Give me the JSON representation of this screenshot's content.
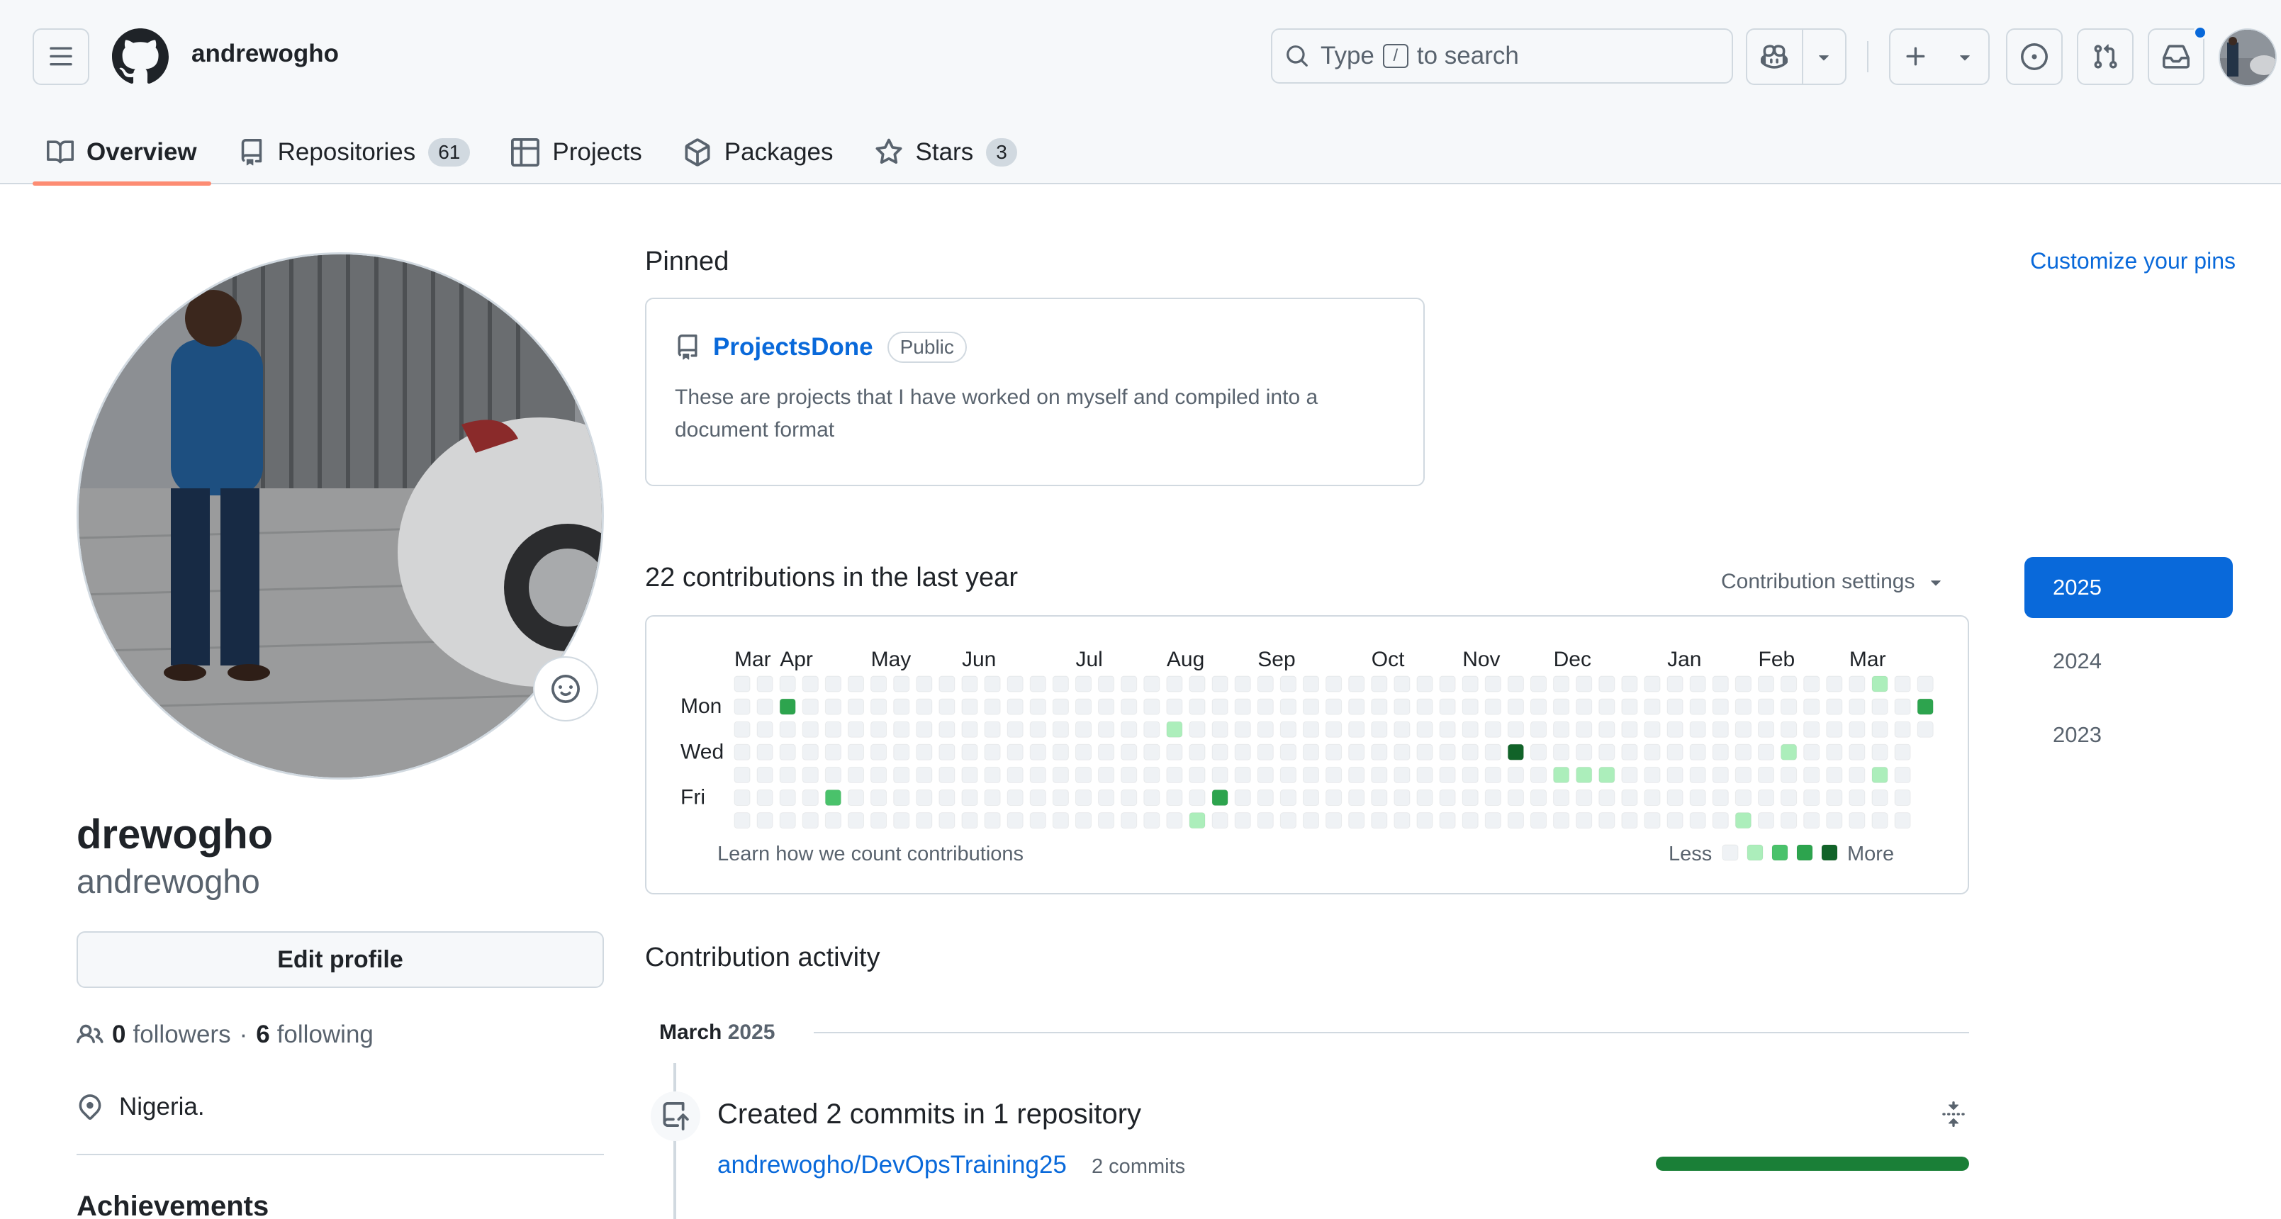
{
  "header": {
    "owner": "andrewogho",
    "search_prefix": "Type",
    "search_key": "/",
    "search_suffix": "to search",
    "icons": [
      "hamburger-icon",
      "github-logo",
      "search-icon",
      "copilot-icon",
      "plus-icon",
      "issue-icon",
      "pull-request-icon",
      "inbox-icon"
    ]
  },
  "tabs": [
    {
      "label": "Overview",
      "icon": "book-icon",
      "active": true
    },
    {
      "label": "Repositories",
      "icon": "repo-icon",
      "count": "61"
    },
    {
      "label": "Projects",
      "icon": "table-icon"
    },
    {
      "label": "Packages",
      "icon": "package-icon"
    },
    {
      "label": "Stars",
      "icon": "star-icon",
      "count": "3"
    }
  ],
  "profile": {
    "name": "drewogho",
    "login": "andrewogho",
    "edit_label": "Edit profile",
    "followers_count": "0",
    "followers_label": "followers",
    "sep": "·",
    "following_count": "6",
    "following_label": "following",
    "location": "Nigeria.",
    "achievements_label": "Achievements"
  },
  "pinned": {
    "title": "Pinned",
    "customize": "Customize your pins",
    "repo": "ProjectsDone",
    "badge": "Public",
    "desc": "These are projects that I have worked on myself and compiled into a document format"
  },
  "contributions": {
    "title": "22 contributions in the last year",
    "settings": "Contribution settings",
    "months": [
      "Mar",
      "Apr",
      "May",
      "Jun",
      "Jul",
      "Aug",
      "Sep",
      "Oct",
      "Nov",
      "Dec",
      "Jan",
      "Feb",
      "Mar"
    ],
    "days": [
      "Mon",
      "Wed",
      "Fri"
    ],
    "learn": "Learn how we count contributions",
    "less": "Less",
    "more": "More",
    "colors": [
      "#eff2f5",
      "#aceebb",
      "#4ac26b",
      "#2da44e",
      "#116329"
    ],
    "weeks": 53,
    "last_week_days": 3,
    "active_cells": [
      {
        "week": 2,
        "day": 1,
        "level": 3
      },
      {
        "week": 4,
        "day": 5,
        "level": 2
      },
      {
        "week": 19,
        "day": 2,
        "level": 1
      },
      {
        "week": 20,
        "day": 6,
        "level": 1
      },
      {
        "week": 21,
        "day": 5,
        "level": 3
      },
      {
        "week": 34,
        "day": 3,
        "level": 4
      },
      {
        "week": 36,
        "day": 4,
        "level": 1
      },
      {
        "week": 37,
        "day": 4,
        "level": 1
      },
      {
        "week": 38,
        "day": 4,
        "level": 1
      },
      {
        "week": 44,
        "day": 6,
        "level": 1
      },
      {
        "week": 46,
        "day": 3,
        "level": 1
      },
      {
        "week": 50,
        "day": 0,
        "level": 1
      },
      {
        "week": 50,
        "day": 4,
        "level": 1
      },
      {
        "week": 52,
        "day": 1,
        "level": 3
      }
    ]
  },
  "years": [
    "2025",
    "2024",
    "2023"
  ],
  "activity": {
    "title": "Contribution activity",
    "month": "March",
    "year": "2025",
    "summary": "Created 2 commits in 1 repository",
    "repo": "andrewogho/DevOpsTraining25",
    "commits": "2 commits",
    "progress": 1.0
  }
}
